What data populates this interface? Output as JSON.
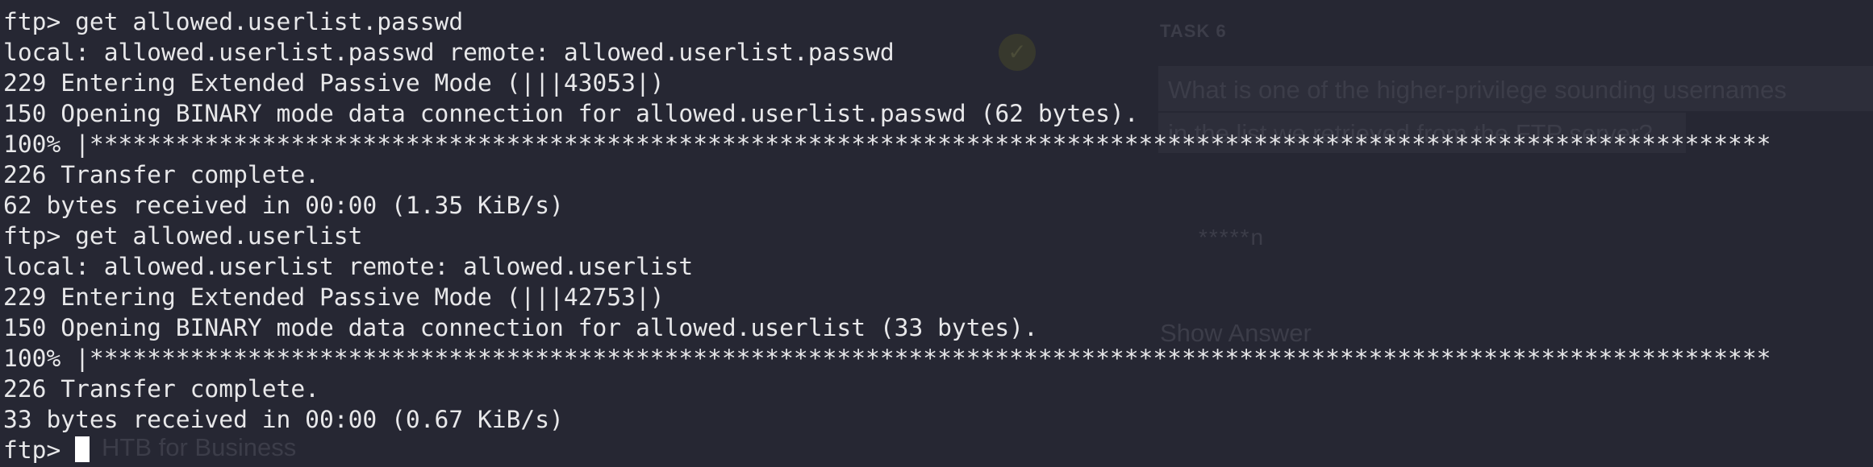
{
  "background_page": {
    "task_label": "TASK 6",
    "question_line_1": "What is one of the higher-privilege sounding usernames",
    "question_line_2": "in the list we retrieved from the FTP server?",
    "answer_mask": "*****n",
    "show_answer_label": "Show Answer",
    "footer_link": "HTB for Business",
    "completed_icon": "check-circle-icon"
  },
  "terminal": {
    "lines": [
      "ftp> get allowed.userlist.passwd",
      "local: allowed.userlist.passwd remote: allowed.userlist.passwd",
      "229 Entering Extended Passive Mode (|||43053|)",
      "150 Opening BINARY mode data connection for allowed.userlist.passwd (62 bytes).",
      "100% |*********************************************************************************************************************",
      "226 Transfer complete.",
      "62 bytes received in 00:00 (1.35 KiB/s)",
      "ftp> get allowed.userlist",
      "local: allowed.userlist remote: allowed.userlist",
      "229 Entering Extended Passive Mode (|||42753|)",
      "150 Opening BINARY mode data connection for allowed.userlist (33 bytes).",
      "100% |*********************************************************************************************************************",
      "226 Transfer complete.",
      "33 bytes received in 00:00 (0.67 KiB/s)"
    ],
    "prompt": "ftp> ",
    "text_color": "#e8e8ea",
    "background_color": "#262733"
  }
}
